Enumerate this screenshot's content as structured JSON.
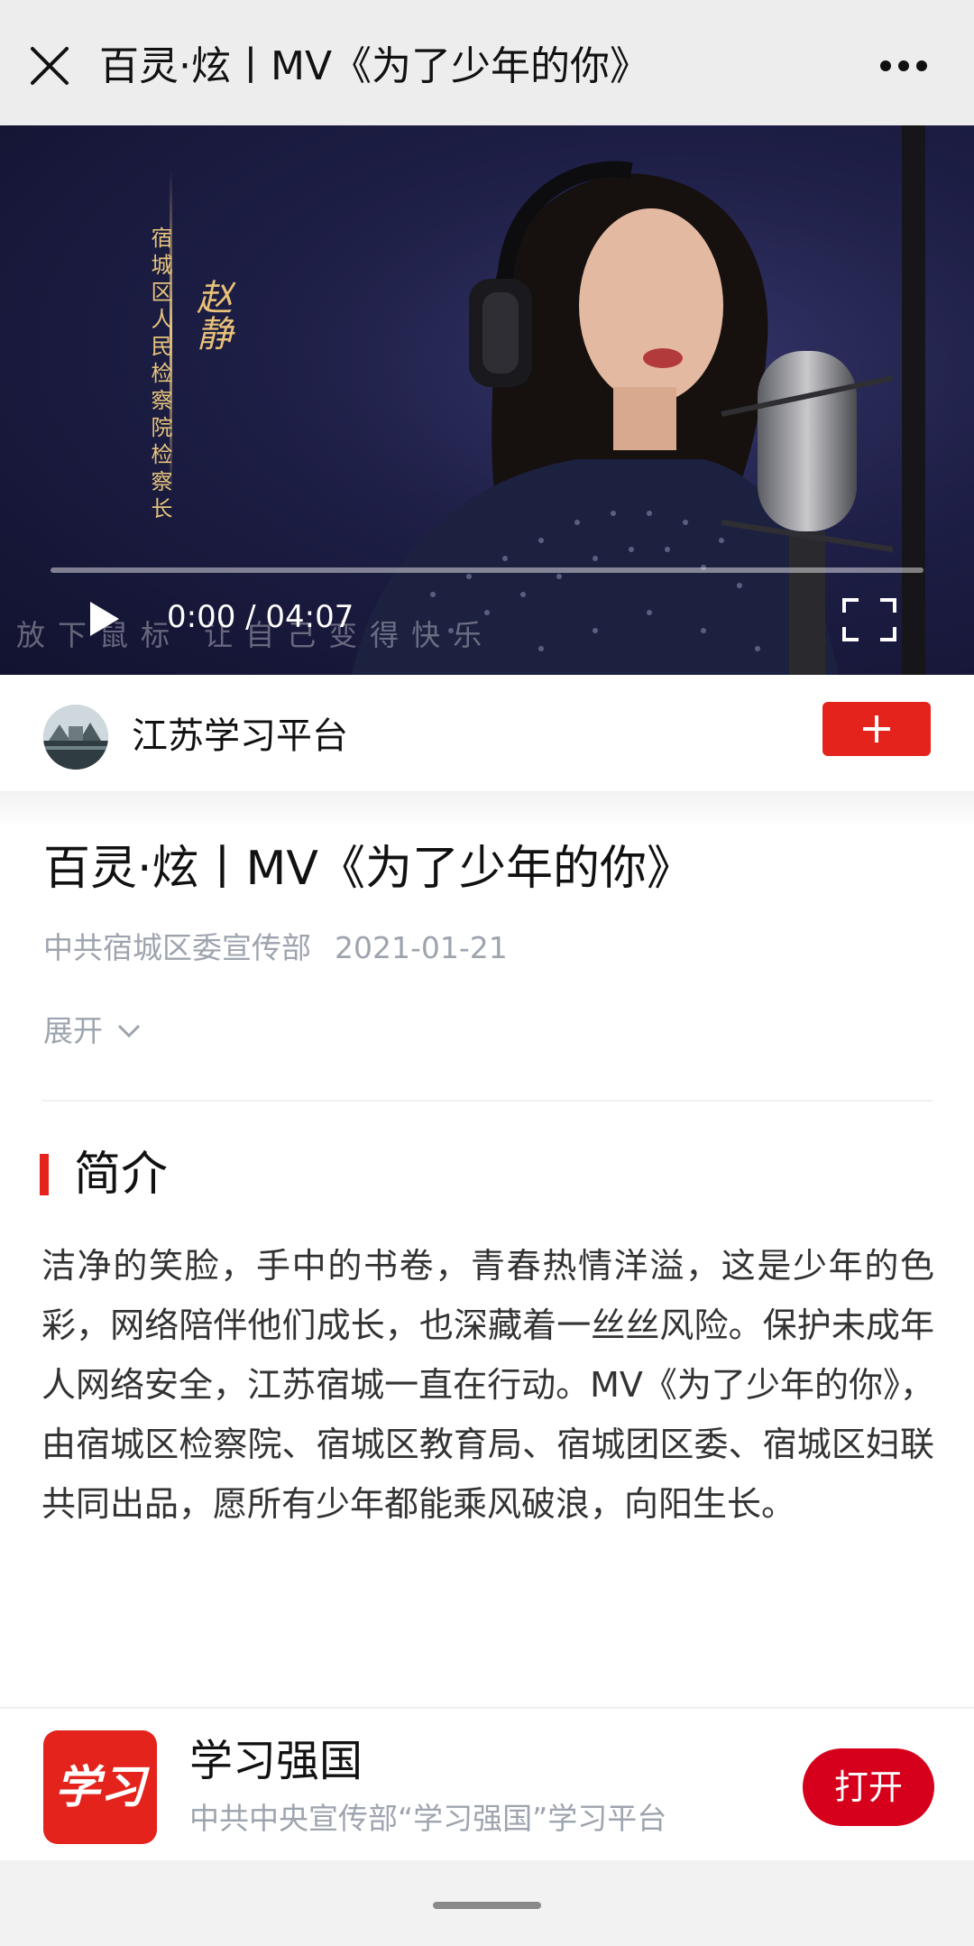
{
  "header": {
    "title": "百灵·炫丨MV《为了少年的你》",
    "close_icon": "close-icon",
    "more_icon": "more-icon"
  },
  "video": {
    "time": "0:00 / 04:07",
    "progress": 0,
    "caption_org": "宿城区人民检察院检察长",
    "caption_person": "赵静",
    "subtitle": "放下鼠标 让自己变得快乐",
    "play_icon": "play-icon",
    "fullscreen_icon": "fullscreen-icon"
  },
  "account": {
    "name": "江苏学习平台",
    "follow_icon": "plus-icon",
    "follow_color": "#e3231c"
  },
  "article": {
    "title": "百灵·炫丨MV《为了少年的你》",
    "source": "中共宿城区委宣传部",
    "date": "2021-01-21",
    "expand_label": "展开"
  },
  "section": {
    "heading": "简介",
    "accent_color": "#e3231c",
    "description": "洁净的笑脸，手中的书卷，青春热情洋溢，这是少年的色彩，网络陪伴他们成长，也深藏着一丝丝风险。保护未成年人网络安全，江苏宿城一直在行动。MV《为了少年的你》，由宿城区检察院、宿城区教育局、宿城团区委、宿城区妇联共同出品，愿所有少年都能乘风破浪，向阳生长。"
  },
  "promo": {
    "logo_text": "学习",
    "app_name": "学习强国",
    "app_desc": "中共中央宣传部“学习强国”学习平台",
    "open_label": "打开",
    "open_color": "#d6001c"
  }
}
